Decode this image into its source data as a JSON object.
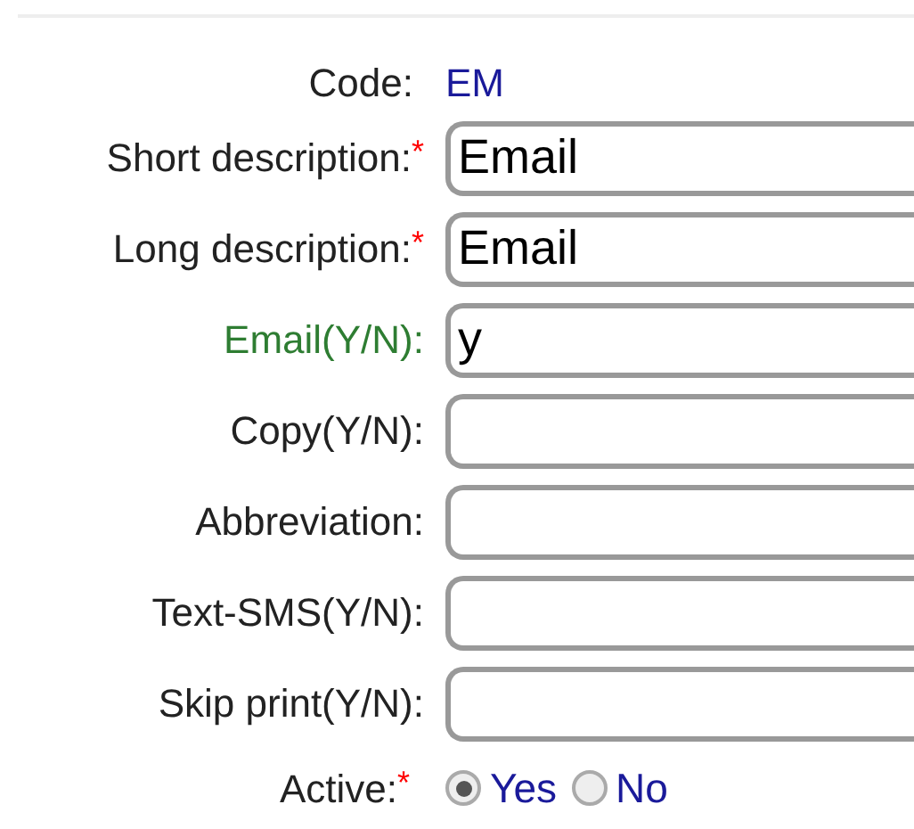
{
  "code": {
    "label": "Code:",
    "value": "EM"
  },
  "fields": [
    {
      "label": "Short description:",
      "required_mark": "*",
      "highlighted": false,
      "value": "Email"
    },
    {
      "label": "Long description:",
      "required_mark": "*",
      "highlighted": false,
      "value": "Email"
    },
    {
      "label": "Email(Y/N):",
      "highlighted": true,
      "value": "y"
    },
    {
      "label": "Copy(Y/N):",
      "highlighted": false
    },
    {
      "label": "Abbreviation:",
      "highlighted": false
    },
    {
      "label": "Text-SMS(Y/N):",
      "highlighted": false
    },
    {
      "label": "Skip print(Y/N):",
      "highlighted": false
    }
  ],
  "active": {
    "label": "Active:",
    "required_mark": "*",
    "options": [
      {
        "label": "Yes",
        "selected": true
      },
      {
        "label": "No",
        "selected": false
      }
    ]
  }
}
